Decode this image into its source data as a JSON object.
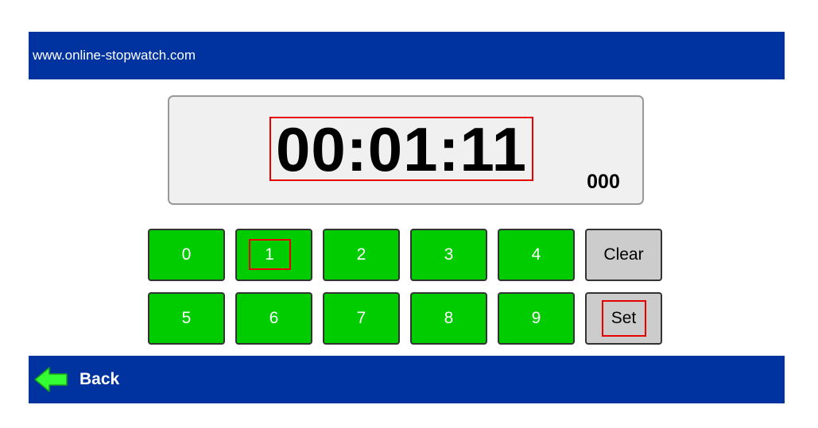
{
  "header": {
    "site_url": "www.online-stopwatch.com"
  },
  "display": {
    "time": "00:01:11",
    "milliseconds": "000"
  },
  "keypad": {
    "row1": [
      "0",
      "1",
      "2",
      "3",
      "4"
    ],
    "row2": [
      "5",
      "6",
      "7",
      "8",
      "9"
    ],
    "clear_label": "Clear",
    "set_label": "Set"
  },
  "footer": {
    "back_label": "Back",
    "back_icon": "left-arrow-icon"
  },
  "colors": {
    "bar_blue": "#0033a0",
    "key_green": "#00cc00",
    "key_gray": "#cccccc",
    "highlight_red": "#e60000",
    "back_arrow_green": "#33ff33"
  }
}
